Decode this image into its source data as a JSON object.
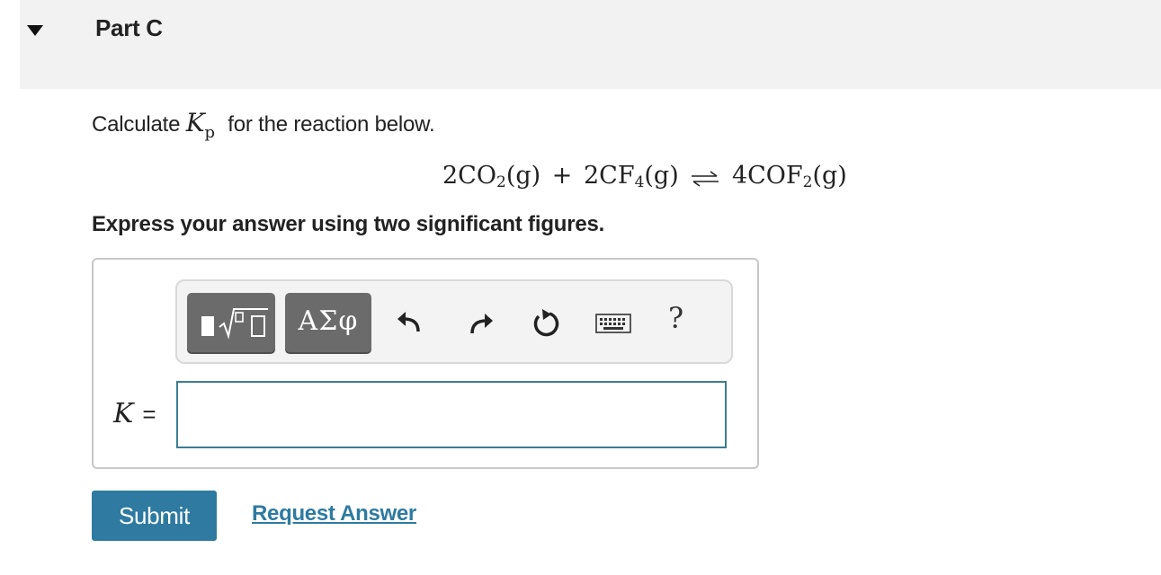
{
  "header": {
    "part_title": "Part C",
    "toggle_icon": "caret-down-icon"
  },
  "question": {
    "prompt_before": "Calculate",
    "k_symbol": "K",
    "k_subscript": "p",
    "prompt_after": "for the reaction below.",
    "equation": {
      "reactant1_coef": "2CO",
      "reactant1_sub": "2",
      "reactant1_state": "(g)",
      "plus": "+",
      "reactant2_coef": "2CF",
      "reactant2_sub": "4",
      "reactant2_state": "(g)",
      "product_coef": "4COF",
      "product_sub": "2",
      "product_state": "(g)",
      "arrow_icon": "equilibrium-arrow-icon"
    },
    "instructions": "Express your answer using two significant figures."
  },
  "toolbar": {
    "templates_icon": "math-templates-icon",
    "greek_label": "ΑΣφ",
    "undo_icon": "undo-icon",
    "redo_icon": "redo-icon",
    "reset_icon": "reset-icon",
    "keyboard_icon": "keyboard-icon",
    "help_label": "?"
  },
  "answer": {
    "variable": "K",
    "equals": "=",
    "value": ""
  },
  "actions": {
    "submit_label": "Submit",
    "request_answer_label": "Request Answer"
  },
  "colors": {
    "header_bg": "#f2f2f2",
    "accent": "#2e7aa0",
    "input_border": "#3c7c95",
    "toolbar_button": "#6b6b6b"
  }
}
